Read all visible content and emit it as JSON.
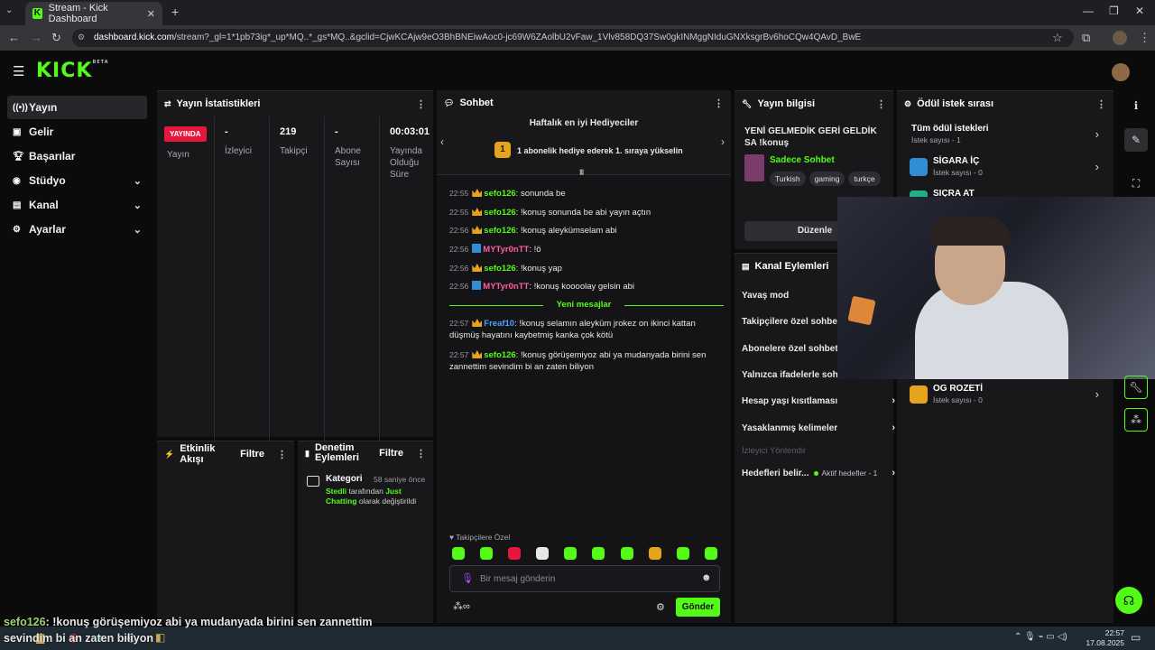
{
  "browser": {
    "tab_title": "Stream - Kick Dashboard",
    "url_host": "dashboard.kick.com",
    "url_rest": "/stream?_gl=1*1pb73ig*_up*MQ..*_gs*MQ..&gclid=CjwKCAjw9eO3BhBNEiwAoc0-jc69W6ZAolbU2vFaw_1Vlv858DQ37Sw0gkINMggNIduGNXksgrBv6hoCQw4QAvD_BwE"
  },
  "app": {
    "logo": "KICK",
    "logo_sup": "BETA"
  },
  "sidebar": {
    "items": [
      {
        "label": "Yayın",
        "icon": "broadcast-icon"
      },
      {
        "label": "Gelir",
        "icon": "revenue-icon"
      },
      {
        "label": "Başarılar",
        "icon": "trophy-icon"
      },
      {
        "label": "Stüdyo",
        "icon": "studio-icon"
      },
      {
        "label": "Kanal",
        "icon": "channel-icon"
      },
      {
        "label": "Ayarlar",
        "icon": "gear-icon"
      }
    ]
  },
  "stats": {
    "title": "Yayın İstatistikleri",
    "status": "YAYINDA",
    "status_label": "Yayın",
    "viewers_value": "-",
    "viewers_label": "İzleyici",
    "followers_value": "219",
    "followers_label": "Takipçi",
    "subs_value": "-",
    "subs_label": "Abone Sayısı",
    "uptime_value": "00:03:01",
    "uptime_label": "Yayında Olduğu Süre"
  },
  "activity": {
    "title": "Etkinlik Akışı",
    "filter": "Filtre"
  },
  "moderation": {
    "title": "Denetim Eylemleri",
    "filter": "Filtre",
    "entry_title": "Kategori",
    "entry_time": "58 saniye önce",
    "entry_user": "Stedli",
    "entry_mid": "tarafından",
    "entry_category": "Just Chatting",
    "entry_end": "olarak değiştirildi"
  },
  "chat": {
    "title": "Sohbet",
    "gifters_title": "Haftalık en iyi Hediyeciler",
    "gifters_rank": "1",
    "gifters_text": "1 abonelik hediye ederek 1. sıraya yükselin",
    "new_messages": "Yeni mesajlar",
    "messages": [
      {
        "time": "22:55",
        "user": "sefo126",
        "color": "#53fc18",
        "badge": "crown",
        "text": ": sonunda be"
      },
      {
        "time": "22:55",
        "user": "sefo126",
        "color": "#53fc18",
        "badge": "crown",
        "text": ": !konuş sonunda be abi yayın açtın"
      },
      {
        "time": "22:56",
        "user": "sefo126",
        "color": "#53fc18",
        "badge": "crown",
        "text": ": !konuş aleykümselam abi"
      },
      {
        "time": "22:56",
        "user": "MYTyr0nTT",
        "color": "#ff5fa2",
        "badge": "blue",
        "text": ": !ö"
      },
      {
        "time": "22:56",
        "user": "sefo126",
        "color": "#53fc18",
        "badge": "crown",
        "text": ": !konuş yap"
      },
      {
        "time": "22:56",
        "user": "MYTyr0nTT",
        "color": "#ff5fa2",
        "badge": "blue",
        "text": ": !konuş koooolay gelsin abi"
      },
      {
        "time": "22:57",
        "user": "Freaf10",
        "color": "#4fa3ff",
        "badge": "crown",
        "text": ": !konuş selamın aleyküm jrokez on ikinci kattan düşmüş hayatını kaybetmiş kanka çok kötü"
      },
      {
        "time": "22:57",
        "user": "sefo126",
        "color": "#53fc18",
        "badge": "crown",
        "text": ": !konuş görüşemiyoz abi ya mudanyada birini sen zannettim sevindim bi an zaten biliyon"
      }
    ],
    "followers_only": "Takipçilere Özel",
    "input_placeholder": "Bir mesaj gönderin",
    "send": "Gönder"
  },
  "stream_info": {
    "title": "Yayın bilgisi",
    "stream_title": "YENİ GELMEDİK GERİ GELDİK SA !konuş",
    "category": "Sadece Sohbet",
    "tags": [
      "Turkish",
      "gaming",
      "turkçe"
    ],
    "edit": "Düzenle"
  },
  "channel_actions": {
    "title": "Kanal Eylemleri",
    "rows": [
      {
        "label": "Yavaş mod"
      },
      {
        "label": "Takipçilere özel sohbet"
      },
      {
        "label": "Abonelere özel sohbet"
      },
      {
        "label": "Yalnızca ifadelerle sohbet"
      },
      {
        "label": "Hesap yaşı kısıtlaması"
      },
      {
        "label": "Yasaklanmış kelimeler"
      }
    ],
    "viewer_direction": "İzleyici Yönlendir",
    "goals_label": "Hedefleri belir...",
    "goals_status": "Aktif hedefler - 1"
  },
  "rewards": {
    "title": "Ödül istek sırası",
    "all_title": "Tüm ödül istekleri",
    "all_count": "İstek sayısı - 1",
    "items": [
      {
        "name": "SİGARA İÇ",
        "count": "İstek sayısı - 0"
      },
      {
        "name": "SIÇRA AT",
        "count": ""
      },
      {
        "name": "OG ROZETİ",
        "count": "İstek sayısı - 0"
      }
    ]
  },
  "overlay": {
    "user": "sefo126",
    "text": ": !konuş görüşemiyoz abi ya mudanyada birini sen zannettim",
    "text2": "sevindim bi an zaten biliyon"
  },
  "taskbar": {
    "time": "22:57",
    "date": "17.08.2025"
  },
  "colors": {
    "accent": "#53fc18",
    "live": "#e5173c",
    "crown": "#e6a41d"
  }
}
